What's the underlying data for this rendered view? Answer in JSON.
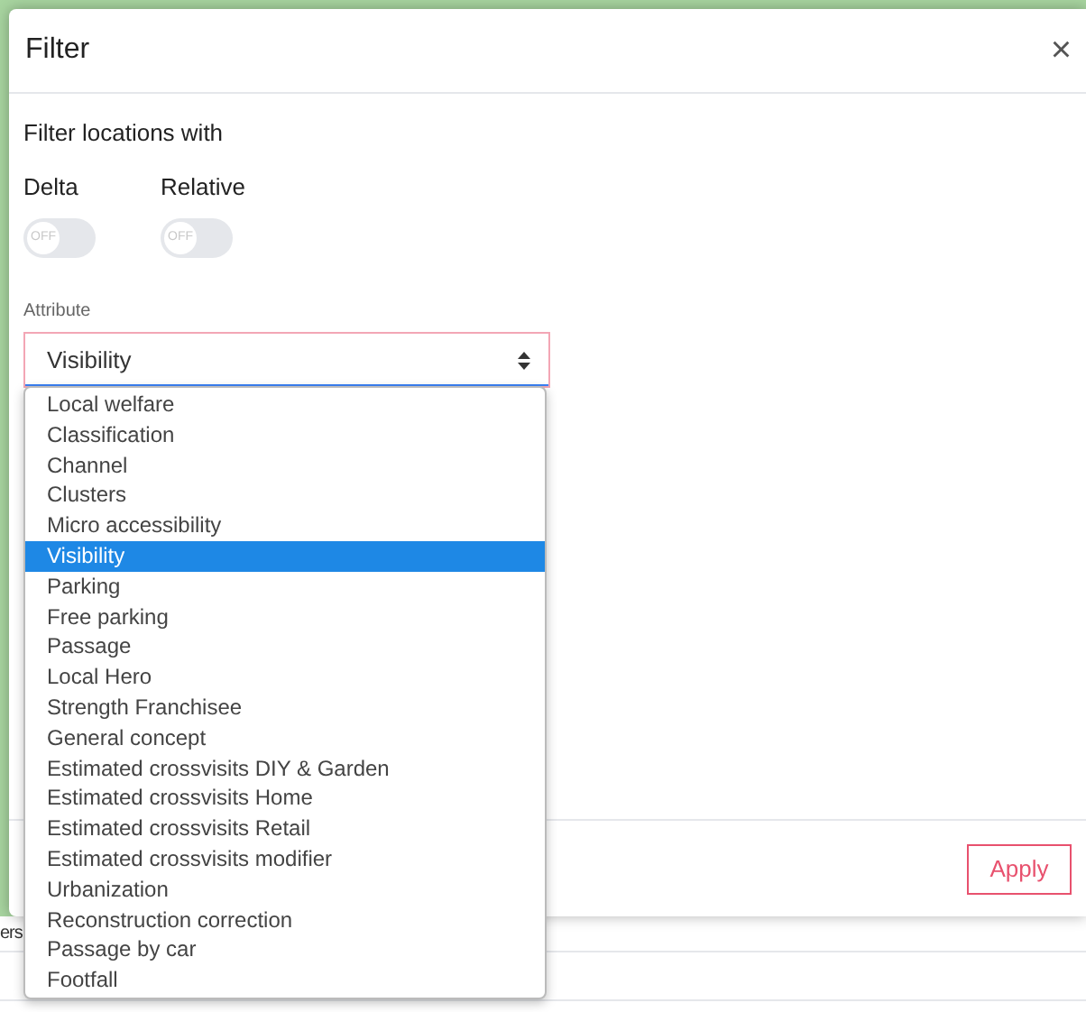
{
  "dialog": {
    "title": "Filter",
    "close": "×",
    "section_title": "Filter locations with",
    "toggles": [
      {
        "label": "Delta",
        "on": false,
        "state_text": "OFF"
      },
      {
        "label": "Relative",
        "on": false,
        "state_text": "OFF"
      }
    ],
    "attribute": {
      "label": "Attribute",
      "value": "Visibility",
      "expanded": true,
      "options": [
        {
          "label": "Local welfare",
          "selected": false
        },
        {
          "label": "Classification",
          "selected": false
        },
        {
          "label": "Channel",
          "selected": false
        },
        {
          "label": "Clusters",
          "selected": false
        },
        {
          "label": "Micro accessibility",
          "selected": false
        },
        {
          "label": "Visibility",
          "selected": true
        },
        {
          "label": "Parking",
          "selected": false
        },
        {
          "label": "Free parking",
          "selected": false
        },
        {
          "label": "Passage",
          "selected": false
        },
        {
          "label": "Local Hero",
          "selected": false
        },
        {
          "label": "Strength Franchisee",
          "selected": false
        },
        {
          "label": "General concept",
          "selected": false
        },
        {
          "label": "Estimated crossvisits DIY & Garden",
          "selected": false
        },
        {
          "label": "Estimated crossvisits Home",
          "selected": false
        },
        {
          "label": "Estimated crossvisits Retail",
          "selected": false
        },
        {
          "label": "Estimated crossvisits modifier",
          "selected": false
        },
        {
          "label": "Urbanization",
          "selected": false
        },
        {
          "label": "Reconstruction correction",
          "selected": false
        },
        {
          "label": "Passage by car",
          "selected": false
        },
        {
          "label": "Footfall",
          "selected": false
        }
      ]
    },
    "apply_button": "Apply"
  },
  "background_text": "ers"
}
